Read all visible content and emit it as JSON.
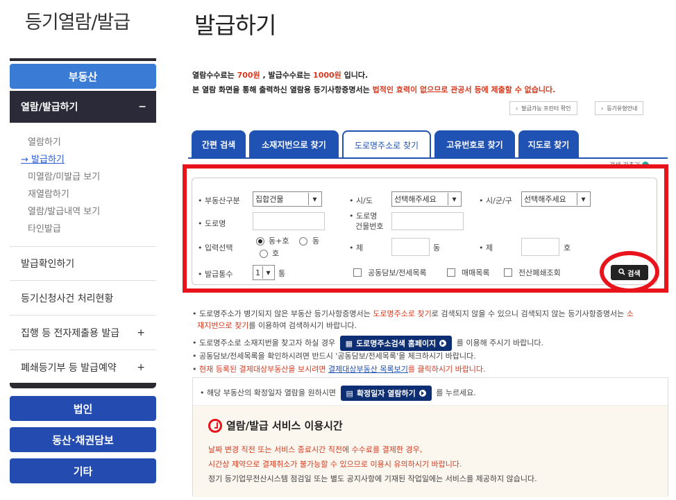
{
  "sidebar": {
    "title": "등기열람/발급",
    "top_button": "부동산",
    "active_section": "열람/발급하기",
    "active_section_toggle": "−",
    "sub_items": [
      "열람하기",
      "발급하기",
      "미열람/미발급 보기",
      "재열람하기",
      "열람/발급내역 보기",
      "타인발급"
    ],
    "current_marker": "→",
    "items": [
      {
        "label": "발급확인하기",
        "toggle": ""
      },
      {
        "label": "등기신청사건 처리현황",
        "toggle": ""
      },
      {
        "label": "집행 등 전자제출용 발급",
        "toggle": "+"
      },
      {
        "label": "폐쇄등기부 등 발급예약",
        "toggle": "+"
      }
    ],
    "bottom_buttons": [
      "법인",
      "동산·채권담보",
      "기타"
    ]
  },
  "main": {
    "title": "발급하기",
    "fee": {
      "prefix": "열람수수료는 ",
      "view_fee": "700원",
      "mid": " , 발급수수료는 ",
      "issue_fee": "1000원",
      "suffix": " 입니다."
    },
    "warning": {
      "prefix": "본 열람 화면을 통해 출력하신 열람용 등기사항증명서는 ",
      "red": "법적인 효력이 없으므로 관공서 등에 제출할 수 없습니다."
    },
    "small_buttons": [
      "발급가능 프린터 확인",
      "등기유형안내"
    ],
    "tabs": [
      "간편 검색",
      "소재지번으로 찾기",
      "도로명주소로 찾기",
      "고유번호로 찾기",
      "지도로 찾기"
    ],
    "active_tab": 2,
    "collapse_label": "검색 감추기"
  },
  "form": {
    "property_type_label": "부동산구분",
    "property_type_value": "집합건물",
    "sido_label": "시/도",
    "sido_value": "선택해주세요",
    "sigungu_label": "시/군/구",
    "sigungu_value": "선택해주세요",
    "road_label": "도로명",
    "building_no_label_1": "도로명",
    "building_no_label_2": "건물번호",
    "input_select_label": "입력선택",
    "radio_options": [
      "동+호",
      "동",
      "호"
    ],
    "dong_prefix_label": "제",
    "dong_unit": "동",
    "ho_prefix_label": "제",
    "ho_unit": "호",
    "count_label": "발급통수",
    "count_value": "1",
    "count_unit": "통",
    "checkboxes": [
      "공동담보/전세목록",
      "매매목록",
      "전산폐쇄조회"
    ],
    "search_button": "검색"
  },
  "notices": {
    "n1_a": "도로명주소가 병기되지 않은 부동산 등기사항증명서는 ",
    "n1_red": "도로명주소로 찾기",
    "n1_b": "로 검색되지 않을 수 있으니 검색되지 않는 등기사항증명서는 ",
    "n1_red2": "소",
    "n1_red3": "재지번으로 찾기",
    "n1_c": "를 이용하여 검색하시기 바랍니다.",
    "n2_a": "도로명주소로 소재지번을 찾고자 하실 경우",
    "n2_btn": "도로명주소검색 홈페이지",
    "n2_b": "를 이용해 주시기 바랍니다.",
    "n3": "공동담보/전세목록을 확인하시려면 반드시 '공동담보/전세목록'을 체크하시기 바랍니다.",
    "n4_red": "현재 등록된 결제대상부동산을 보시려면 ",
    "n4_link": "결제대상부동산 목록보기",
    "n4_b": "를 클릭하시기 바랍니다.",
    "n5_a": "해당 부동산의 확정일자 열람을 원하시면",
    "n5_btn": "확정일자 열람하기",
    "n5_b": "를 누르세요."
  },
  "service": {
    "title": "열람/발급 서비스 이용시간",
    "line1": "날짜 변경 직전 또는 서비스 종료시간 직전에 수수료를 결제한 경우,",
    "line2": "시간상 제약으로 결제취소가 불가능할 수 있으므로 이용시 유의하시기 바랍니다.",
    "line3": "정기 등기업무전산시스템 점검일 또는 별도 공지사항에 기재된 작업일에는 서비스를 제공하지 않습니다."
  },
  "colors": {
    "primary_blue": "#1f52b3",
    "sidebar_blue": "#3a7bd5",
    "highlight_red": "#e8131b",
    "notice_red": "#d63a1f"
  }
}
